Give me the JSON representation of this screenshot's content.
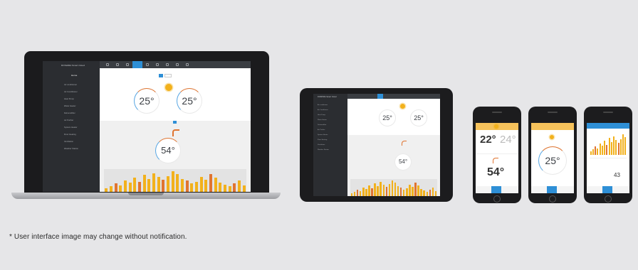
{
  "laptop_app": {
    "title": "DOSHIRA Smart Cloud",
    "menu_header": "Home",
    "sidebar_items": [
      "Air conditioner",
      "Air Conditioner",
      "Heat Pump",
      "Water Heater",
      "Dehumidifier",
      "Air Purifier",
      "System Heater",
      "Floor Heating",
      "Ventilation",
      "Weather Station"
    ],
    "dial_left": "25°",
    "dial_right": "25°",
    "dial_water": "54°"
  },
  "tablet_app": {
    "title": "DOSHIRA Smart Cloud",
    "dial_left": "25°",
    "dial_right": "25°",
    "dial_water": "54°"
  },
  "phone1": {
    "temp_left": "22°",
    "temp_right": "24°",
    "water_temp": "54°"
  },
  "phone2": {
    "setpoint": "25°"
  },
  "phone3": {
    "value": "43"
  },
  "chart_bars": [
    4,
    6,
    9,
    7,
    12,
    10,
    15,
    11,
    18,
    14,
    20,
    16,
    13,
    17,
    22,
    19,
    14,
    12,
    9,
    11,
    16,
    13,
    19,
    15,
    10,
    8,
    6,
    9,
    12,
    7
  ],
  "colors": {
    "accent": "#2e8fd6",
    "orange": "#e07430",
    "yellow": "#f2b11c",
    "sidebar": "#2b2d31"
  },
  "disclaimer": "* User interface image may change without notification."
}
